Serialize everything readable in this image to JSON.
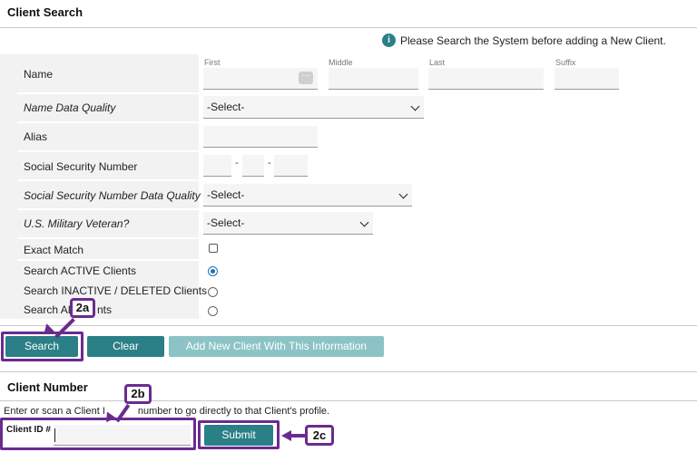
{
  "client_search": {
    "title": "Client Search",
    "notice": "Please Search the System before adding a New Client.",
    "name_label": "Name",
    "name_fields": {
      "first_label": "First",
      "middle_label": "Middle",
      "last_label": "Last",
      "suffix_label": "Suffix",
      "first_value": "",
      "middle_value": "",
      "last_value": "",
      "suffix_value": ""
    },
    "name_data_quality": {
      "label": "Name Data Quality",
      "selected": "-Select-"
    },
    "alias": {
      "label": "Alias",
      "value": ""
    },
    "ssn": {
      "label": "Social Security Number",
      "part1": "",
      "part2": "",
      "part3": "",
      "sep": "-"
    },
    "ssn_data_quality": {
      "label": "Social Security Number Data Quality",
      "selected": "-Select-"
    },
    "veteran": {
      "label": "U.S. Military Veteran?",
      "selected": "-Select-"
    },
    "exact_match": {
      "label": "Exact Match",
      "checked": false
    },
    "search_active": {
      "label": "Search ACTIVE Clients",
      "selected": true
    },
    "search_inactive": {
      "label": "Search INACTIVE / DELETED Clients",
      "selected": false
    },
    "search_all": {
      "label": "Search AL",
      "label_tail": "nts",
      "selected": false
    },
    "buttons": {
      "search": "Search",
      "clear": "Clear",
      "add_new": "Add New Client With This Information"
    }
  },
  "client_number": {
    "title": "Client Number",
    "instructions_pre": "Enter or scan a Client ",
    "instructions_mid": "I",
    "instructions_post": " number to go directly to that Client's profile.",
    "client_id_label": "Client ID #",
    "client_id_value": "",
    "submit": "Submit"
  },
  "annotations": {
    "callout_2a": "2a",
    "callout_2b": "2b",
    "callout_2c": "2c",
    "accent_color": "#6a2b8f"
  },
  "colors": {
    "button_teal": "#2b7f86",
    "button_disabled": "#8cc3c6",
    "info_icon": "#2b7f86"
  }
}
